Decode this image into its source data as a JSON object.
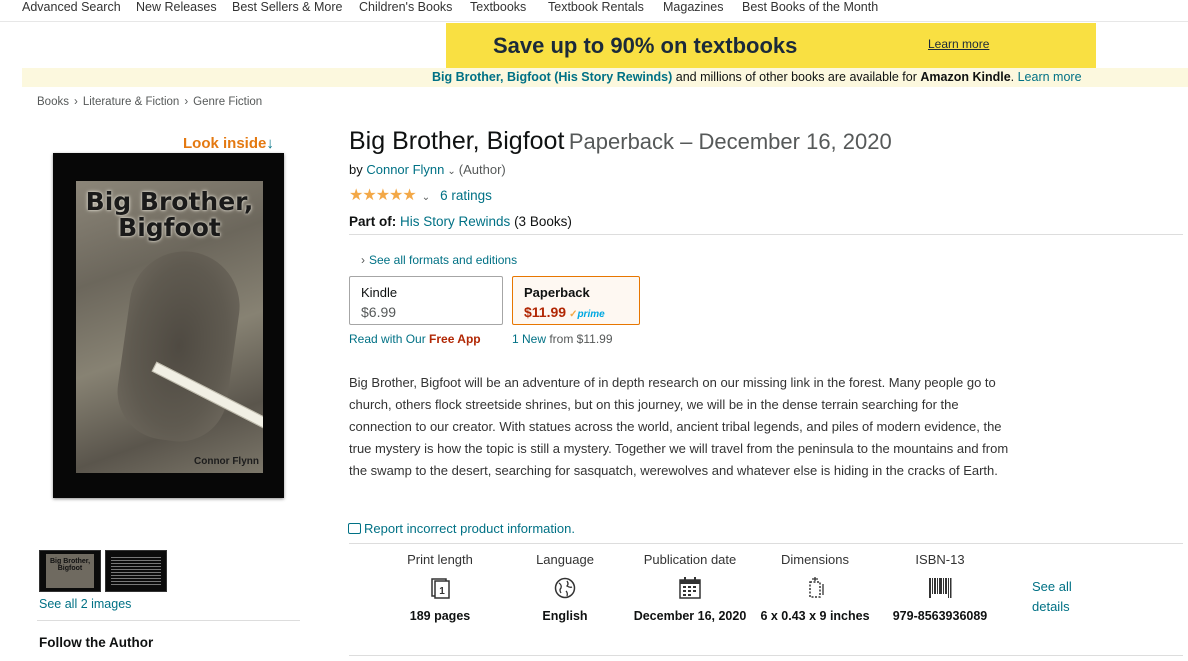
{
  "topnav": {
    "items": [
      "Advanced Search",
      "New Releases",
      "Best Sellers & More",
      "Children's Books",
      "Textbooks",
      "Textbook Rentals",
      "Magazines",
      "Best Books of the Month"
    ]
  },
  "promo": {
    "text": "Save up to 90% on textbooks",
    "link": "Learn more"
  },
  "kindle_bar": {
    "book_link": "Big Brother, Bigfoot (His Story Rewinds)",
    "mid_text": " and millions of other books are available for ",
    "kindle": "Amazon Kindle",
    "after": ". ",
    "learn_more": "Learn more"
  },
  "breadcrumb": [
    "Books",
    "Literature & Fiction",
    "Genre Fiction"
  ],
  "breadcrumb_sep": "›",
  "look_inside": {
    "label": "Look inside",
    "arrow": "↓"
  },
  "cover": {
    "title_line1": "Big Brother,",
    "title_line2": "Bigfoot",
    "author": "Connor Flynn"
  },
  "thumbs": {
    "title": "Big Brother, Bigfoot",
    "see_all": "See all 2 images"
  },
  "follow_author": "Follow the Author",
  "product": {
    "title": "Big Brother, Bigfoot",
    "format_date": "Paperback – December 16, 2020",
    "by": "by ",
    "author": "Connor Flynn",
    "chev": "⌄",
    "role": "(Author)",
    "stars": "★★★★★",
    "ratings": "6 ratings",
    "part_of_label": "Part of:",
    "series": "His Story Rewinds",
    "series_count": "(3 Books)"
  },
  "formats": {
    "see_all": "See all formats and editions",
    "chev": "›",
    "kindle": {
      "name": "Kindle",
      "price": "$6.99"
    },
    "paperback": {
      "name": "Paperback",
      "price": "$11.99",
      "prime": "prime"
    },
    "kindle_note_pre": "Read with Our ",
    "kindle_note_app": "Free App",
    "paperback_note_new": "1 New",
    "paperback_note_from": " from $11.99"
  },
  "description": "Big Brother, Bigfoot will be an adventure of in depth research on our missing link in the forest. Many people go to church, others flock streetside shrines, but on this journey, we will be in the dense terrain searching for the connection to our creator. With statues across the world, ancient tribal legends, and piles of modern evidence, the true mystery is how the topic is still a mystery. Together we will travel from the peninsula to the mountains and from the swamp to the desert, searching for sasquatch, werewolves and whatever else is hiding in the cracks of Earth.",
  "report": "Report incorrect product information.",
  "details": [
    {
      "label": "Print length",
      "icon": "book-pages-icon",
      "value": "189 pages"
    },
    {
      "label": "Language",
      "icon": "globe-icon",
      "value": "English"
    },
    {
      "label": "Publication date",
      "icon": "calendar-icon",
      "value": "December 16, 2020"
    },
    {
      "label": "Dimensions",
      "icon": "dimensions-icon",
      "value": "6 x 0.43 x 9 inches"
    },
    {
      "label": "ISBN-13",
      "icon": "barcode-icon",
      "value": "979-8563936089"
    }
  ],
  "see_all_details": "See all details",
  "colors": {
    "link": "#007185",
    "price": "#b12704",
    "star": "#f3a847",
    "banner": "#f9e042",
    "kindle_bar": "#fcf8de",
    "look_inside": "#e47911"
  }
}
